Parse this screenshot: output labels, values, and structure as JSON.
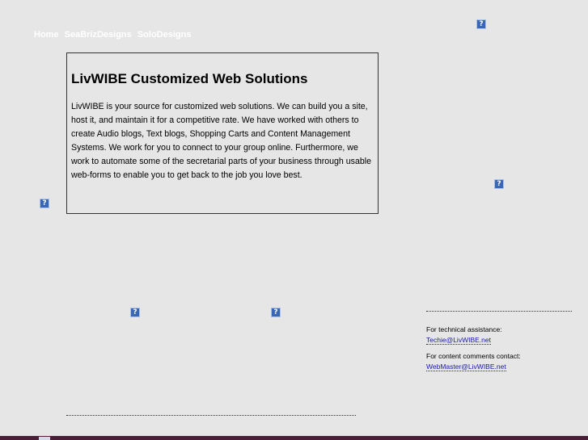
{
  "nav": {
    "items": [
      {
        "label": "Home"
      },
      {
        "label": "SeaBrizDesigns"
      },
      {
        "label": "SoloDesigns"
      }
    ]
  },
  "broken_image_glyph": "?",
  "main": {
    "title": "LivWIBE Customized Web Solutions",
    "body": "LivWIBE is your source for customized web solutions. We can build you a site, host it, and maintain it for a competitive rate. We have worked with others to create Audio blogs, Text blogs, Shopping Carts and Content Management Systems. We work for you to connect to your group online. Furthermore, we work to automate some of the secretarial parts of your business through usable web-forms to enable you to get back to the job you love best."
  },
  "contact": {
    "tech_label": "For technical assistance:",
    "tech_email": "Techie@LivWIBE.net",
    "content_label": "For content comments contact:",
    "content_email": "WebMaster@LivWIBE.net"
  },
  "colors": {
    "background": "#e6e6e6",
    "link": "#1a1aa6",
    "footer_bar": "#4a1e36"
  },
  "icons": {
    "broken_image": "broken-image-icon"
  }
}
